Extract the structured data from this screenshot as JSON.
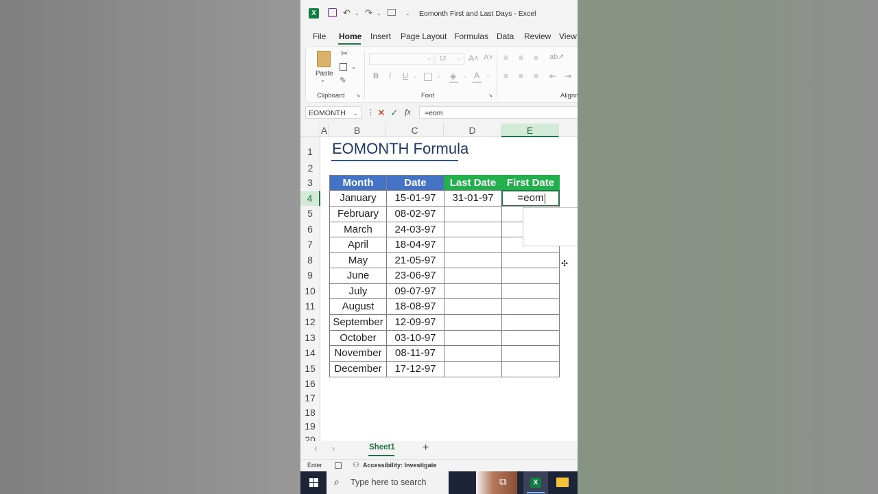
{
  "window": {
    "title": "Eomonth First and Last Days  -  Excel",
    "app_icon": "excel-icon"
  },
  "menu": [
    "File",
    "Home",
    "Insert",
    "Page Layout",
    "Formulas",
    "Data",
    "Review",
    "View"
  ],
  "ribbon": {
    "paste_label": "Paste",
    "font_size": "12",
    "bold": "B",
    "italic": "I",
    "underline": "U",
    "groups": [
      "Clipboard",
      "Font",
      "Alignm"
    ]
  },
  "formula_bar": {
    "name_box": "EOMONTH",
    "fx": "fx",
    "formula": "=eom"
  },
  "columns": [
    "A",
    "B",
    "C",
    "D",
    "E"
  ],
  "rows": [
    "1",
    "2",
    "3",
    "4",
    "5",
    "6",
    "7",
    "8",
    "9",
    "10",
    "11",
    "12",
    "13",
    "14",
    "15",
    "16",
    "17",
    "18",
    "19",
    "20"
  ],
  "sheet": {
    "title": "EOMONTH Formula",
    "headers": [
      "Month",
      "Date",
      "Last Date",
      "First Date"
    ],
    "data": [
      [
        "January",
        "15-01-97",
        "31-01-97",
        "=eom"
      ],
      [
        "February",
        "08-02-97",
        "",
        ""
      ],
      [
        "March",
        "24-03-97",
        "",
        ""
      ],
      [
        "April",
        "18-04-97",
        "",
        ""
      ],
      [
        "May",
        "21-05-97",
        "",
        ""
      ],
      [
        "June",
        "23-06-97",
        "",
        ""
      ],
      [
        "July",
        "09-07-97",
        "",
        ""
      ],
      [
        "August",
        "18-08-97",
        "",
        ""
      ],
      [
        "September",
        "12-09-97",
        "",
        ""
      ],
      [
        "October",
        "03-10-97",
        "",
        ""
      ],
      [
        "November",
        "08-11-97",
        "",
        ""
      ],
      [
        "December",
        "17-12-97",
        "",
        ""
      ]
    ]
  },
  "tabs": {
    "sheet_name": "Sheet1",
    "add": "+"
  },
  "status": {
    "mode": "Enter",
    "accessibility": "Accessibility: Investigate"
  },
  "taskbar": {
    "search_placeholder": "Type here to search"
  },
  "colors": {
    "excel_green": "#217346",
    "header_blue": "#4472c4",
    "header_green": "#21b04b",
    "title_navy": "#1f3864"
  }
}
